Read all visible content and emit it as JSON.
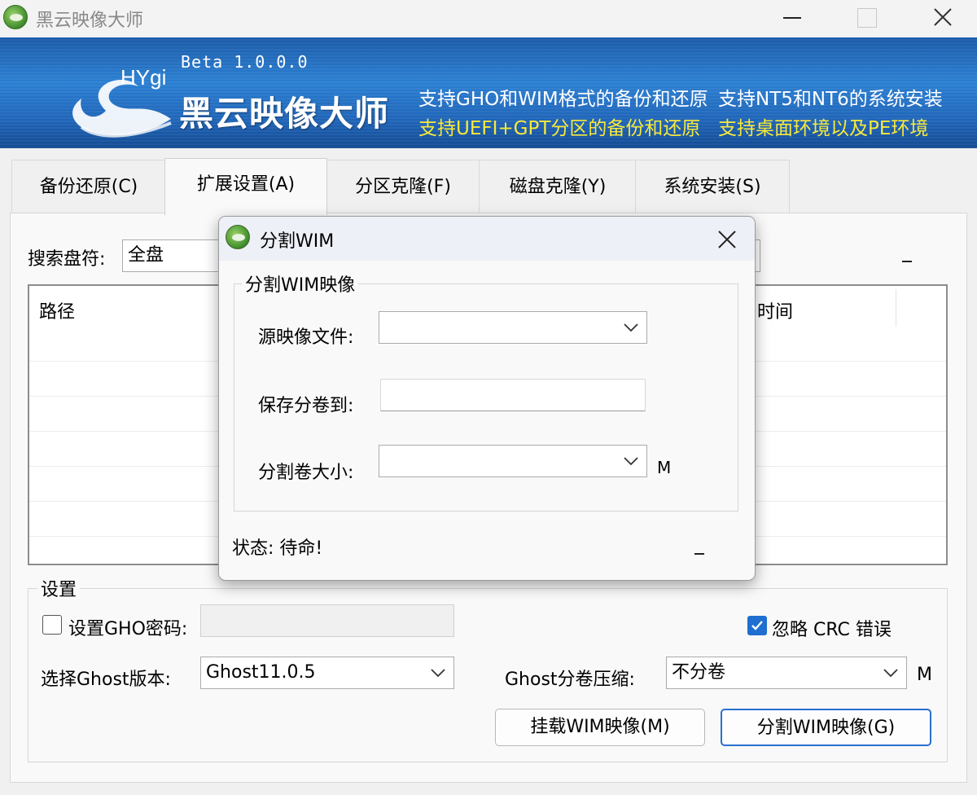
{
  "window": {
    "title": "黑云映像大师",
    "controls": {
      "minimize": "minimize",
      "maximize": "maximize",
      "close": "close"
    }
  },
  "banner": {
    "logo_text": "HYgi",
    "version": "Beta 1.0.0.0",
    "app_name": "黑云映像大师",
    "features": [
      {
        "text": "支持GHO和WIM格式的备份和还原",
        "color": "#ffffff"
      },
      {
        "text": "支持NT5和NT6的系统安装",
        "color": "#ffffff"
      },
      {
        "text": "支持UEFI+GPT分区的备份和还原",
        "color": "#f8e93a"
      },
      {
        "text": "支持桌面环境以及PE环境",
        "color": "#f8e93a"
      }
    ]
  },
  "tabs": [
    {
      "label": "备份还原(C)",
      "active": false
    },
    {
      "label": "扩展设置(A)",
      "active": true
    },
    {
      "label": "分区克隆(F)",
      "active": false
    },
    {
      "label": "磁盘克隆(Y)",
      "active": false
    },
    {
      "label": "系统安装(S)",
      "active": false
    }
  ],
  "search": {
    "label": "搜索盘符:",
    "value": "全盘"
  },
  "list": {
    "columns": [
      "路径",
      "时间"
    ]
  },
  "settings": {
    "group_title": "设置",
    "gho_password": {
      "label": "设置GHO密码:",
      "checked": false,
      "value": ""
    },
    "ignore_crc": {
      "label": "忽略 CRC 错误",
      "checked": true
    },
    "ghost_version": {
      "label": "选择Ghost版本:",
      "value": "Ghost11.0.5"
    },
    "ghost_split": {
      "label": "Ghost分卷压缩:",
      "value": "不分卷",
      "unit": "M"
    },
    "mount_button": "挂载WIM映像(M)",
    "split_button": "分割WIM映像(G)"
  },
  "dialog": {
    "title": "分割WIM",
    "group_title": "分割WIM映像",
    "source_label": "源映像文件:",
    "source_value": "",
    "save_label": "保存分卷到:",
    "save_value": "",
    "size_label": "分割卷大小:",
    "size_value": "",
    "size_unit": "M",
    "status": "状态: 待命!"
  },
  "colors": {
    "accent": "#1e6fd0",
    "banner_blue": "#1f64b8",
    "feature_yellow": "#f8e93a"
  }
}
